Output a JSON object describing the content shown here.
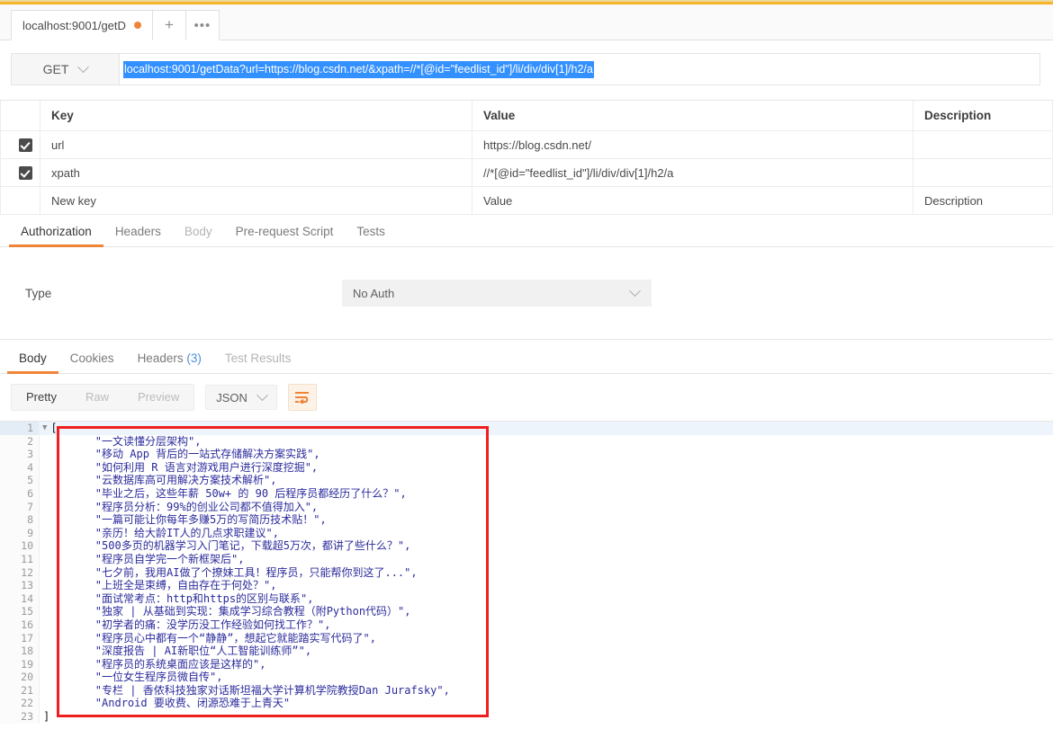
{
  "window": {
    "accent_color": "#f5b62c",
    "highlight_color": "#ef8437"
  },
  "tabstrip": {
    "request_tab_label": "localhost:9001/getD",
    "unsaved_dot": "●",
    "new_tab_label": "+",
    "more_label": "•••"
  },
  "urlbar": {
    "method": "GET",
    "url": "localhost:9001/getData?url=https://blog.csdn.net/&xpath=//*[@id=\"feedlist_id\"]/li/div/div[1]/h2/a"
  },
  "params": {
    "columns": [
      "Key",
      "Value",
      "Description"
    ],
    "rows": [
      {
        "checked": true,
        "key": "url",
        "value": "https://blog.csdn.net/",
        "description": ""
      },
      {
        "checked": true,
        "key": "xpath",
        "value": "//*[@id=\"feedlist_id\"]/li/div/div[1]/h2/a",
        "description": ""
      }
    ],
    "new_row": {
      "key_placeholder": "New key",
      "value_placeholder": "Value",
      "description_placeholder": "Description"
    }
  },
  "request_tabs": [
    {
      "label": "Authorization",
      "state": "active"
    },
    {
      "label": "Headers",
      "state": "enabled"
    },
    {
      "label": "Body",
      "state": "disabled"
    },
    {
      "label": "Pre-request Script",
      "state": "enabled"
    },
    {
      "label": "Tests",
      "state": "enabled"
    }
  ],
  "authorization": {
    "type_label": "Type",
    "type_value": "No Auth"
  },
  "response_tabs": [
    {
      "label": "Body",
      "state": "active",
      "count": ""
    },
    {
      "label": "Cookies",
      "state": "enabled",
      "count": ""
    },
    {
      "label": "Headers",
      "state": "enabled",
      "count": "(3)"
    },
    {
      "label": "Test Results",
      "state": "enabled",
      "count": ""
    }
  ],
  "response_toolbar": {
    "view_modes": [
      "Pretty",
      "Raw",
      "Preview"
    ],
    "active_view_mode": "Pretty",
    "format": "JSON",
    "wrap_icon": "wrap-lines-icon"
  },
  "code": {
    "lines": [
      {
        "n": "1",
        "text": "[",
        "brace": true,
        "fold": true
      },
      {
        "n": "2",
        "text": "\"一文读懂分层架构\","
      },
      {
        "n": "3",
        "text": "\"移动 App 背后的一站式存储解决方案实践\","
      },
      {
        "n": "4",
        "text": "\"如何利用 R 语言对游戏用户进行深度挖掘\","
      },
      {
        "n": "5",
        "text": "\"云数据库高可用解决方案技术解析\","
      },
      {
        "n": "6",
        "text": "\"毕业之后，这些年薪 50w+ 的 90 后程序员都经历了什么？\","
      },
      {
        "n": "7",
        "text": "\"程序员分析：99%的创业公司都不值得加入\","
      },
      {
        "n": "8",
        "text": "\"一篇可能让你每年多赚5万的写简历技术贴！\","
      },
      {
        "n": "9",
        "text": "\"亲历！给大龄IT人的几点求职建议\","
      },
      {
        "n": "10",
        "text": "\"500多页的机器学习入门笔记，下载超5万次，都讲了些什么？\","
      },
      {
        "n": "11",
        "text": "\"程序员自学完一个新框架后\","
      },
      {
        "n": "12",
        "text": "\"七夕前，我用AI做了个撩妹工具！程序员，只能帮你到这了...\","
      },
      {
        "n": "13",
        "text": "\"上班全是束缚，自由存在于何处？\","
      },
      {
        "n": "14",
        "text": "\"面试常考点：http和https的区别与联系\","
      },
      {
        "n": "15",
        "text": "\"独家 | 从基础到实现：集成学习综合教程（附Python代码）\","
      },
      {
        "n": "16",
        "text": "\"初学者的痛：没学历没工作经验如何找工作？\","
      },
      {
        "n": "17",
        "text": "\"程序员心中都有一个“静静”，想起它就能踏实写代码了\","
      },
      {
        "n": "18",
        "text": "\"深度报告 | AI新职位“人工智能训练师”\","
      },
      {
        "n": "19",
        "text": "\"程序员的系统桌面应该是这样的\","
      },
      {
        "n": "20",
        "text": "\"一位女生程序员微自传\","
      },
      {
        "n": "21",
        "text": "\"专栏 | 香侬科技独家对话斯坦福大学计算机学院教授Dan Jurafsky\","
      },
      {
        "n": "22",
        "text": "\"Android 要收费、闭源恐难于上青天\""
      },
      {
        "n": "23",
        "text": "]",
        "brace": true
      }
    ]
  },
  "annotation": {
    "type": "red-rectangle-highlight",
    "color": "#ef1f1f"
  }
}
